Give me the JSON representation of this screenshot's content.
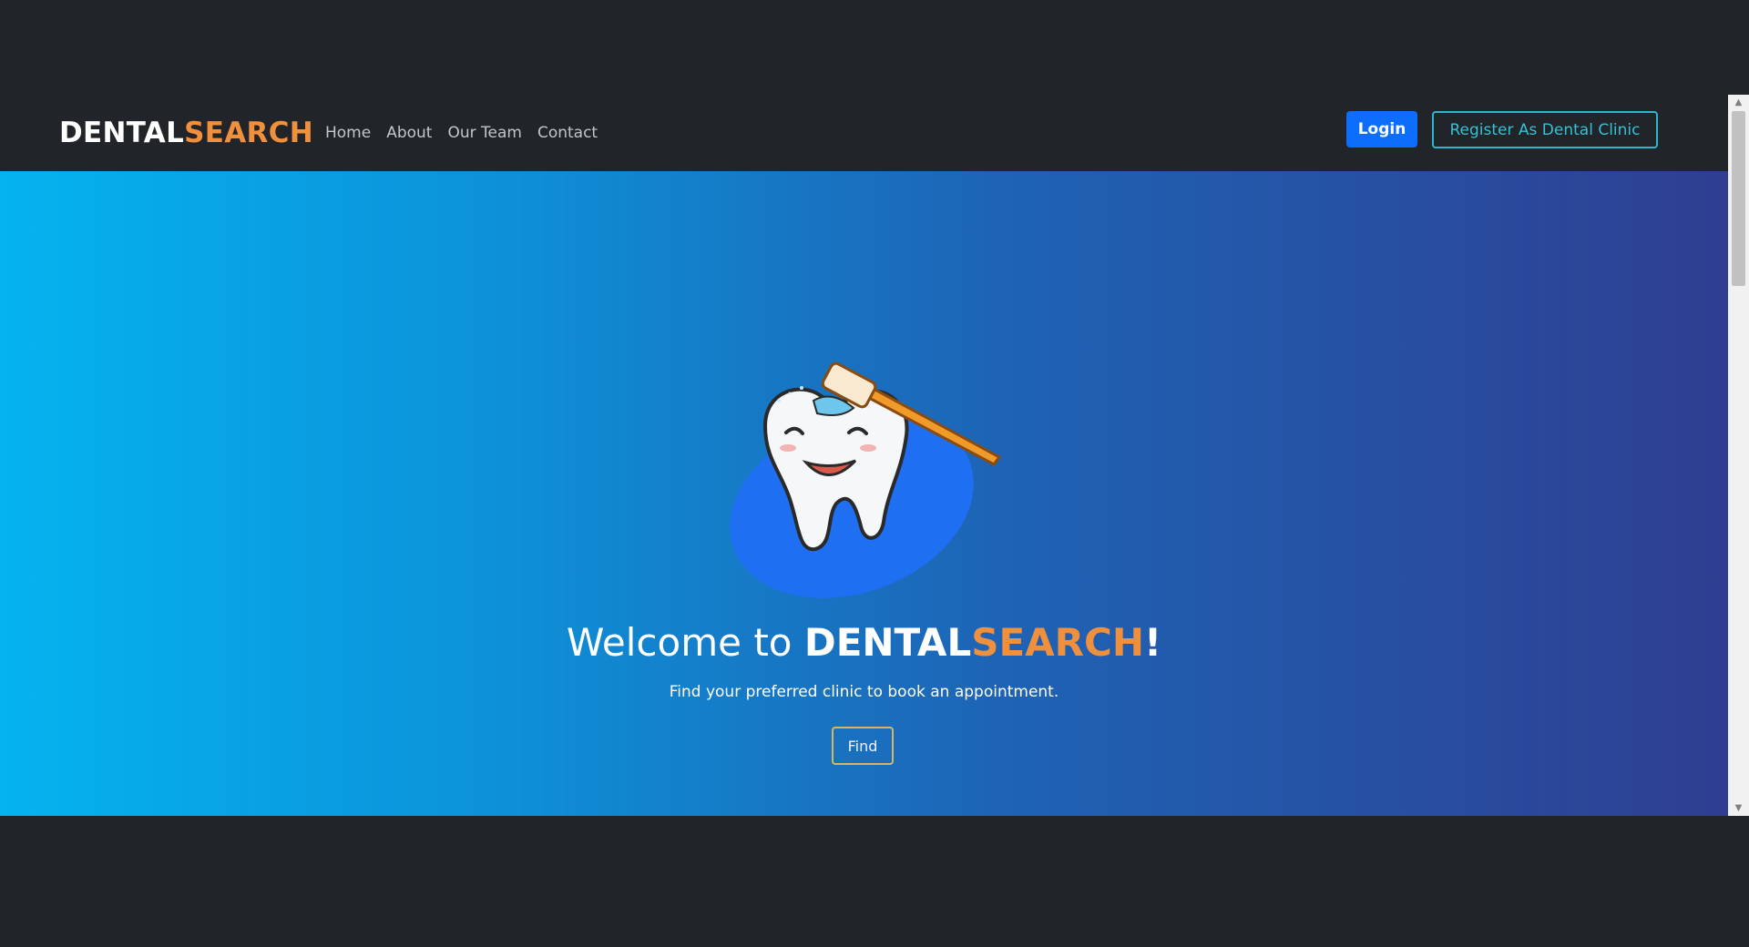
{
  "navbar": {
    "brand_part1": "DENTAL",
    "brand_part2": "SEARCH",
    "links": [
      "Home",
      "About",
      "Our Team",
      "Contact"
    ],
    "login_label": "Login",
    "register_label": "Register As Dental Clinic"
  },
  "hero": {
    "welcome_prefix": "Welcome to ",
    "welcome_brand1": "DENTAL",
    "welcome_brand2": "SEARCH",
    "welcome_suffix": "!",
    "subtitle": "Find your preferred clinic to book an appointment.",
    "find_label": "Find",
    "illustration": "tooth-brushing-icon"
  },
  "colors": {
    "navbar_bg": "#212429",
    "brand_accent": "#f08f3c",
    "login_bg": "#0d6efd",
    "register_border": "#2bb8cc",
    "hero_gradient_start": "#04b3ef",
    "hero_gradient_end": "#2f3e91"
  }
}
